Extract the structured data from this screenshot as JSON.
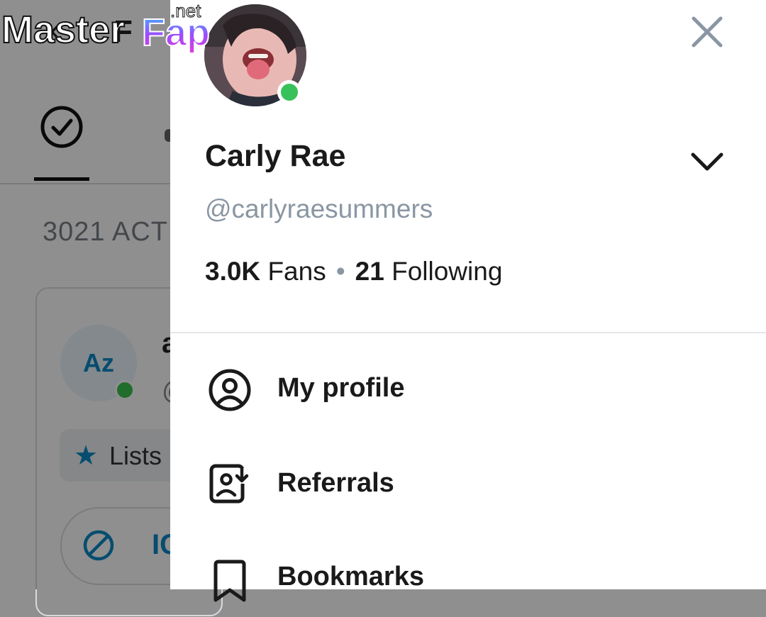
{
  "watermark": {
    "brand_part1": "Master",
    "brand_part2": "Fap",
    "suffix": ".net"
  },
  "background_page": {
    "title_partial": "F",
    "count_text": "3021 ACT",
    "card": {
      "avatar_initials": "Az",
      "name_partial": "a",
      "handle_partial": "@",
      "lists_chip_label": "Lists",
      "block_label_partial": "IC"
    }
  },
  "drawer": {
    "profile": {
      "display_name": "Carly Rae",
      "username": "@carlyraesummers",
      "fans_count": "3.0K",
      "fans_label": "Fans",
      "separator": "•",
      "following_count": "21",
      "following_label": "Following",
      "online": true
    },
    "menu": [
      {
        "label": "My profile",
        "icon": "user-circle-icon"
      },
      {
        "label": "Referrals",
        "icon": "referral-icon"
      },
      {
        "label": "Bookmarks",
        "icon": "bookmark-icon"
      }
    ]
  },
  "colors": {
    "online_green": "#38c15a",
    "muted_text": "#8a96a3",
    "accent_blue": "#0c8ac6"
  }
}
